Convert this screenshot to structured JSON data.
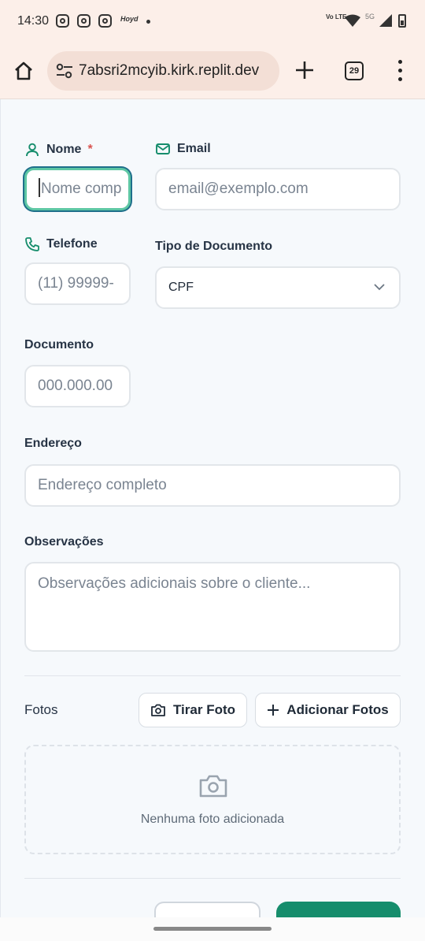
{
  "status_bar": {
    "time": "14:30",
    "app_label": "Hoyd",
    "network": "Vo LTE",
    "network_5g": "5G"
  },
  "browser": {
    "url": "7absri2mcyib.kirk.replit.dev",
    "tab_count": "29"
  },
  "form": {
    "name": {
      "label": "Nome",
      "required_mark": "*",
      "placeholder": "Nome comp"
    },
    "email": {
      "label": "Email",
      "placeholder": "email@exemplo.com"
    },
    "phone": {
      "label": "Telefone",
      "placeholder": "(11) 99999-"
    },
    "doc_type": {
      "label": "Tipo de Documento",
      "value": "CPF"
    },
    "document": {
      "label": "Documento",
      "placeholder": "000.000.00"
    },
    "address": {
      "label": "Endereço",
      "placeholder": "Endereço completo"
    },
    "notes": {
      "label": "Observações",
      "placeholder": "Observações adicionais sobre o cliente..."
    }
  },
  "photos": {
    "label": "Fotos",
    "take_photo": "Tirar Foto",
    "add_photos": "Adicionar Fotos",
    "empty_text": "Nenhuma foto adicionada"
  },
  "colors": {
    "accent_green": "#168d6c",
    "focus_ring": "#5ec7a4",
    "required_red": "#d9534f"
  }
}
